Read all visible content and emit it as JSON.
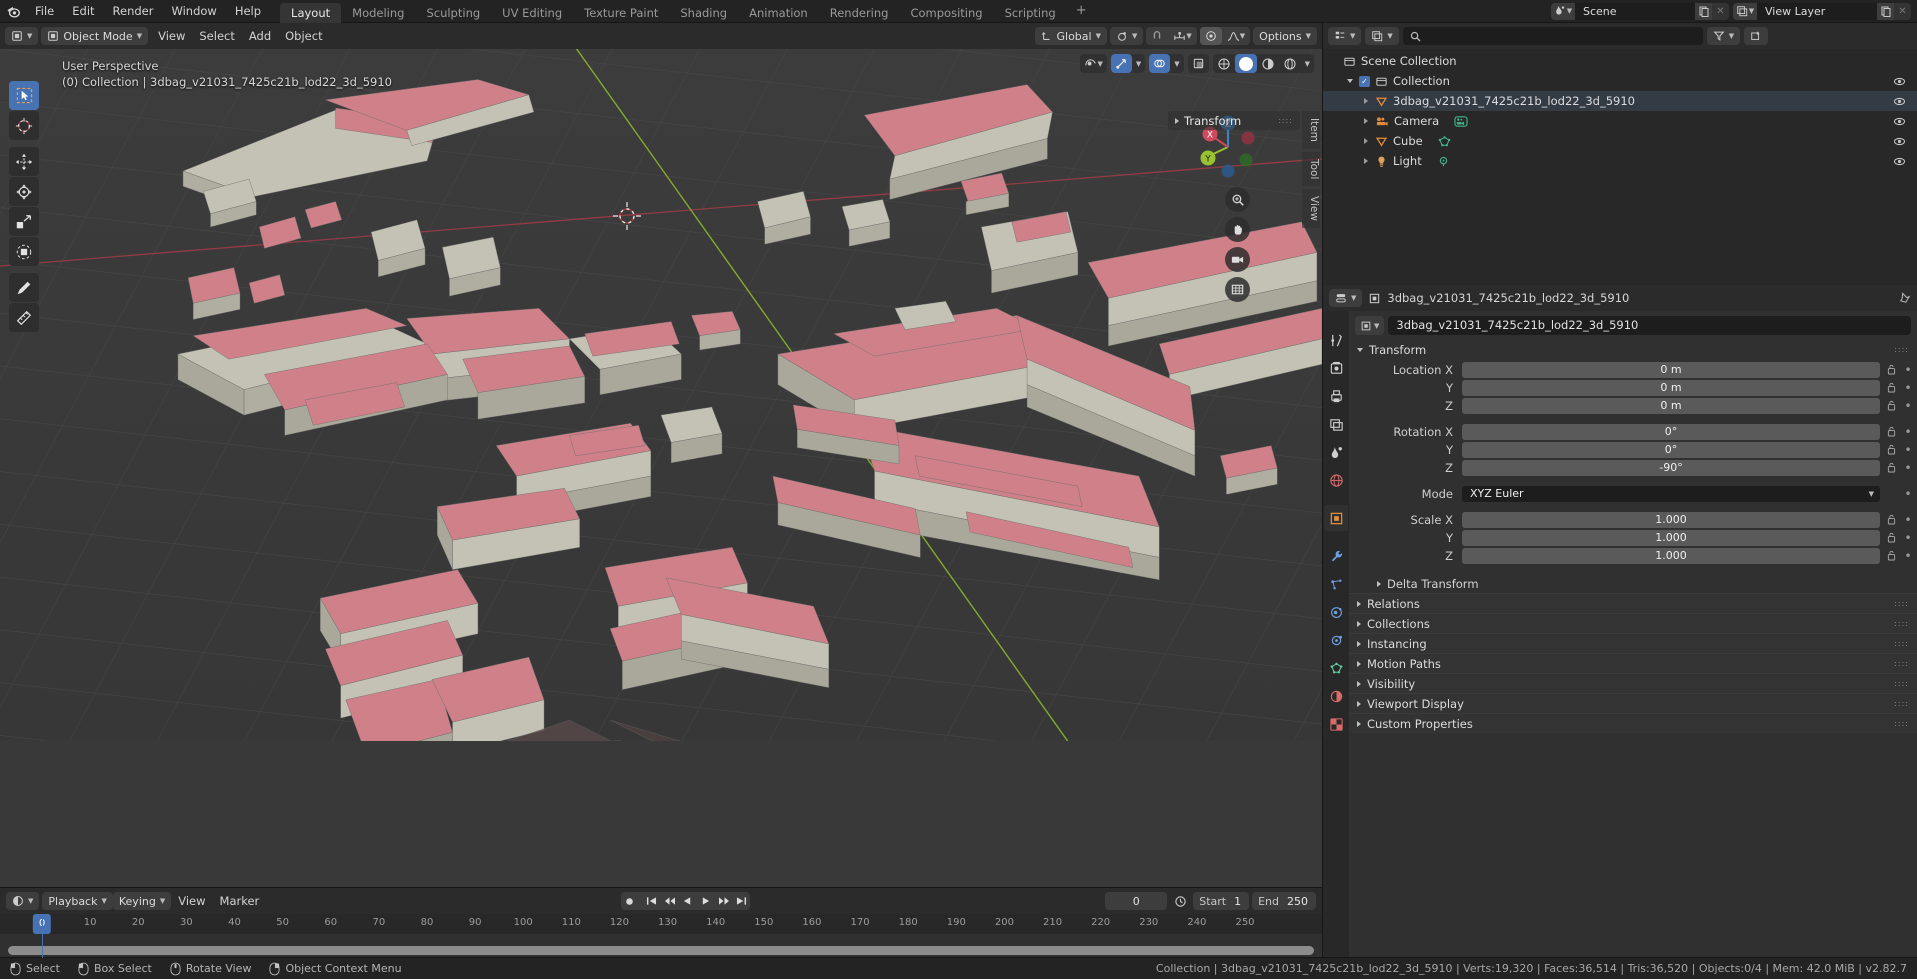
{
  "app": {
    "version": "v2.82.7",
    "accent": "#4772b3",
    "bg_dark": "#232323",
    "bg_panel": "#303030",
    "viewport_bg": "#393939",
    "object_color": "#c97d85"
  },
  "topbar": {
    "logo": "blender-logo",
    "menus": [
      "File",
      "Edit",
      "Render",
      "Window",
      "Help"
    ],
    "workspaces": [
      {
        "label": "Layout",
        "active": true
      },
      {
        "label": "Modeling",
        "active": false
      },
      {
        "label": "Sculpting",
        "active": false
      },
      {
        "label": "UV Editing",
        "active": false
      },
      {
        "label": "Texture Paint",
        "active": false
      },
      {
        "label": "Shading",
        "active": false
      },
      {
        "label": "Animation",
        "active": false
      },
      {
        "label": "Rendering",
        "active": false
      },
      {
        "label": "Compositing",
        "active": false
      },
      {
        "label": "Scripting",
        "active": false
      }
    ],
    "add_workspace": "+",
    "scene": {
      "label": "Scene",
      "new_icon": "copy-icon",
      "remove_icon": "x-icon"
    },
    "view_layer": {
      "label": "View Layer",
      "new_icon": "copy-icon",
      "remove_icon": "x-icon"
    }
  },
  "viewport_header": {
    "editor_type_icon": "editor-type-icon",
    "mode": "Object Mode",
    "menus": [
      "View",
      "Select",
      "Add",
      "Object"
    ],
    "transform_orientation": "Global",
    "pivot_icon": "pivot-icon",
    "snap_icon": "snap-magnet-icon",
    "snap_to_icon": "snap-increment-icon",
    "proportional_icon": "proportional-edit-icon",
    "falloff_icon": "falloff-curve-icon",
    "options": "Options"
  },
  "viewport_overlay": {
    "perspective": "User Perspective",
    "info": "(0) Collection | 3dbag_v21031_7425c21b_lod22_3d_5910"
  },
  "viewport_right_controls": {
    "visibility_icon": "object-visibility-icon",
    "gizmo_icon": "gizmo-icon",
    "overlays_icon": "overlays-icon",
    "xray_icon": "xray-toggle-icon",
    "shading_modes": [
      "wireframe",
      "solid",
      "material",
      "rendered"
    ],
    "active_shading": "solid"
  },
  "nav_gizmo": {
    "axes": [
      {
        "label": "X",
        "color": "#cc4a5b"
      },
      {
        "label": "Y",
        "color": "#9ac22e"
      },
      {
        "label": "Z",
        "color": "#3b84cc"
      }
    ],
    "buttons": [
      "zoom-icon",
      "pan-hand-icon",
      "camera-icon",
      "ortho-persp-grid-icon"
    ]
  },
  "n_panel": {
    "header": "Transform",
    "tabs": [
      "Item",
      "Tool",
      "View"
    ]
  },
  "tool_shelf": {
    "tools": [
      {
        "name": "tweak-select-box-icon",
        "active": true
      },
      {
        "name": "cursor-icon",
        "active": false
      },
      {
        "name": "move-icon",
        "active": false
      },
      {
        "name": "rotate-icon",
        "active": false
      },
      {
        "name": "scale-icon",
        "active": false
      },
      {
        "name": "transform-icon",
        "active": false
      },
      {
        "name": "annotate-icon",
        "active": false
      },
      {
        "name": "measure-icon",
        "active": false
      }
    ]
  },
  "outliner": {
    "display_mode_icon": "outliner-display-icon",
    "filter_id_icon": "filter-id-icon",
    "search_icon": "search-icon",
    "search_placeholder": "",
    "filter_icon": "funnel-icon",
    "new_collection_icon": "new-collection-icon",
    "rows": [
      {
        "label": "Scene Collection",
        "indent": 0,
        "icon": "scene-collection-icon",
        "has_disclosure": false,
        "has_checkbox": false,
        "has_eye": false,
        "selected": false,
        "data_icon": null
      },
      {
        "label": "Collection",
        "indent": 1,
        "icon": "collection-icon",
        "has_disclosure": true,
        "disclosure": "down",
        "has_checkbox": true,
        "has_eye": true,
        "selected": false,
        "data_icon": null
      },
      {
        "label": "3dbag_v21031_7425c21b_lod22_3d_5910",
        "indent": 2,
        "icon": "mesh-object-icon",
        "has_disclosure": true,
        "disclosure": "right",
        "has_checkbox": false,
        "has_eye": true,
        "selected": true,
        "data_icon": null
      },
      {
        "label": "Camera",
        "indent": 2,
        "icon": "camera-object-icon",
        "has_disclosure": true,
        "disclosure": "right",
        "has_checkbox": false,
        "has_eye": true,
        "selected": false,
        "data_icon": "camera-data-icon"
      },
      {
        "label": "Cube",
        "indent": 2,
        "icon": "mesh-object-icon",
        "has_disclosure": true,
        "disclosure": "right",
        "has_checkbox": false,
        "has_eye": true,
        "selected": false,
        "data_icon": "mesh-data-icon"
      },
      {
        "label": "Light",
        "indent": 2,
        "icon": "light-object-icon",
        "has_disclosure": true,
        "disclosure": "right",
        "has_checkbox": false,
        "has_eye": true,
        "selected": false,
        "data_icon": "light-data-icon"
      }
    ]
  },
  "properties": {
    "editor_icon": "properties-editor-icon",
    "breadcrumb": "3dbag_v21031_7425c21b_lod22_3d_5910",
    "pin_icon": "pin-icon",
    "object_name": "3dbag_v21031_7425c21b_lod22_3d_5910",
    "object_icon": "object-data-icon",
    "tabs": [
      {
        "name": "tool-tab",
        "icon": "tool-icon",
        "active": false,
        "color": "#cfcfcf"
      },
      {
        "name": "render-tab",
        "icon": "render-camera-icon",
        "active": false,
        "color": "#cfcfcf"
      },
      {
        "name": "output-tab",
        "icon": "printer-icon",
        "active": false,
        "color": "#cfcfcf"
      },
      {
        "name": "view-layer-tab",
        "icon": "images-icon",
        "active": false,
        "color": "#cfcfcf"
      },
      {
        "name": "scene-tab",
        "icon": "scene-cone-icon",
        "active": false,
        "color": "#cfcfcf"
      },
      {
        "name": "world-tab",
        "icon": "world-globe-icon",
        "active": false,
        "color": "#d96a6a"
      },
      {
        "name": "object-tab",
        "icon": "object-square-icon",
        "active": true,
        "color": "#e8903a"
      },
      {
        "name": "modifier-tab",
        "icon": "wrench-icon",
        "active": false,
        "color": "#6d9fe0"
      },
      {
        "name": "particles-tab",
        "icon": "particles-icon",
        "active": false,
        "color": "#6d9fe0"
      },
      {
        "name": "physics-tab",
        "icon": "physics-orbit-icon",
        "active": false,
        "color": "#6d9fe0"
      },
      {
        "name": "constraints-tab",
        "icon": "constraint-icon",
        "active": false,
        "color": "#6d9fe0"
      },
      {
        "name": "data-tab",
        "icon": "mesh-data-green-icon",
        "active": false,
        "color": "#5fcf9e"
      },
      {
        "name": "material-tab",
        "icon": "material-sphere-icon",
        "active": false,
        "color": "#d96a6a"
      },
      {
        "name": "texture-tab",
        "icon": "texture-checker-icon",
        "active": false,
        "color": "#d96a6a"
      }
    ],
    "transform": {
      "title": "Transform",
      "location": {
        "label": "Location X",
        "x": "0 m",
        "y": "0 m",
        "z": "0 m"
      },
      "rotation": {
        "label": "Rotation X",
        "x": "0°",
        "y": "0°",
        "z": "-90°"
      },
      "mode": {
        "label": "Mode",
        "value": "XYZ Euler"
      },
      "scale": {
        "label": "Scale X",
        "x": "1.000",
        "y": "1.000",
        "z": "1.000"
      },
      "axis_y": "Y",
      "axis_z": "Z",
      "delta_transform": "Delta Transform"
    },
    "sections": [
      "Relations",
      "Collections",
      "Instancing",
      "Motion Paths",
      "Visibility",
      "Viewport Display",
      "Custom Properties"
    ]
  },
  "timeline": {
    "editor_icon": "timeline-editor-icon",
    "menus": [
      "Playback",
      "Keying",
      "View",
      "Marker"
    ],
    "record_icon": "record-icon",
    "transport": [
      "jump-start-icon",
      "prev-keyframe-icon",
      "play-reverse-icon",
      "play-icon",
      "next-keyframe-icon",
      "jump-end-icon"
    ],
    "current_frame": "0",
    "auto_key_icon": "auto-key-icon",
    "start_label": "Start",
    "start_value": "1",
    "end_label": "End",
    "end_value": "250",
    "ticks": [
      0,
      10,
      20,
      30,
      40,
      50,
      60,
      70,
      80,
      90,
      100,
      110,
      120,
      130,
      140,
      150,
      160,
      170,
      180,
      190,
      200,
      210,
      220,
      230,
      240,
      250
    ],
    "playhead_frame": 0
  },
  "statusbar": {
    "hints": [
      {
        "icon": "mouse-left-icon",
        "label": "Select"
      },
      {
        "icon": "mouse-left-drag-icon",
        "label": "Box Select"
      },
      {
        "icon": "mouse-middle-icon",
        "label": "Rotate View"
      },
      {
        "icon": "mouse-right-icon",
        "label": "Object Context Menu"
      }
    ],
    "scene_stats": "Collection | 3dbag_v21031_7425c21b_lod22_3d_5910 | Verts:19,320 | Faces:36,514 | Tris:36,520 | Objects:0/4 | Mem: 42.0 MiB | v2.82.7"
  }
}
